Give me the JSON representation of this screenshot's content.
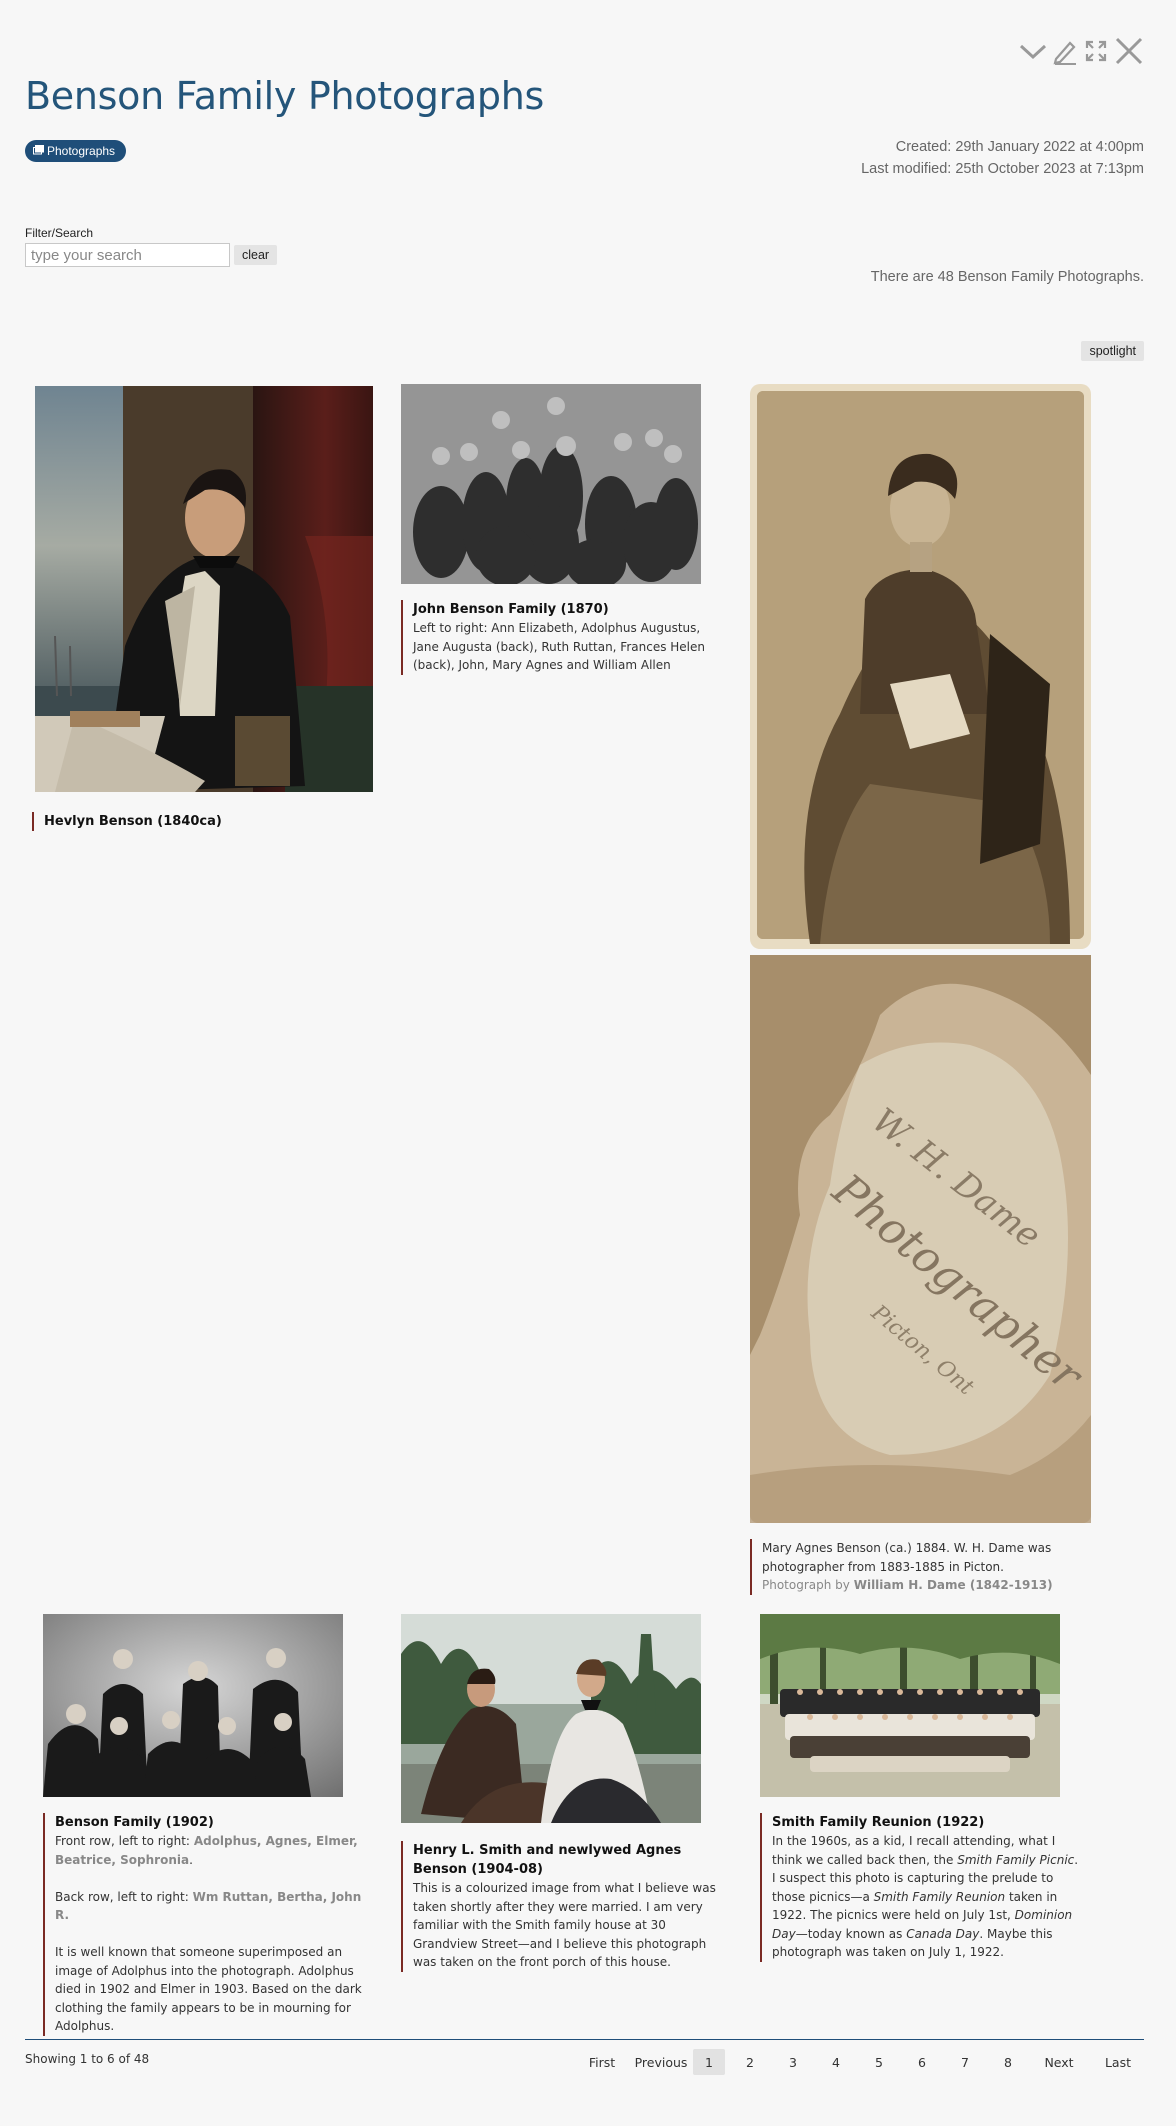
{
  "window_controls": {
    "collapse": "chevron-down-icon",
    "edit": "pencil-icon",
    "expand": "expand-icon",
    "close": "close-icon"
  },
  "title": "Benson Family Photographs",
  "tag": {
    "icon": "photos-icon",
    "label": "Photographs"
  },
  "meta": {
    "created": "Created: 29th January 2022 at 4:00pm",
    "modified": "Last modified: 25th October 2023 at 7:13pm"
  },
  "filter": {
    "label": "Filter/Search",
    "placeholder": "type your search",
    "clear": "clear"
  },
  "count_text": "There are 48 Benson Family Photographs.",
  "spotlight": "spotlight",
  "items": [
    {
      "title": "Hevlyn Benson (1840ca)"
    },
    {
      "title": "John Benson Family (1870)",
      "desc": "Left to right: Ann Elizabeth, Adolphus Augustus, Jane Augusta (back), Ruth Ruttan, Frances Helen (back), John, Mary Agnes and William Allen"
    },
    {
      "desc": "Mary Agnes Benson (ca.) 1884. W. H. Dame was photo­grapher from 1883-1885 in Picton.",
      "credit_prefix": "Photograph by",
      "credit_name": "William H. Dame (1842-1913)",
      "back_text_1": "W. H. Dame",
      "back_text_2": "Photographer",
      "back_text_3": "Picton, Ont"
    },
    {
      "title": "Benson Family (1902)",
      "front_prefix": "Front row, left to right:",
      "front_names": "Adolphus, Agnes, Elmer, Beatrice, Sophronia",
      "back_prefix": "Back row, left to right:",
      "back_names": "Wm Ruttan, Bertha, John R.",
      "note": "It is well known that someone superimposed an image of Adolphus into the photograph. Adolphus died in 1902 and Elmer in 1903. Based on the dark clothing the family appears to be in mourning for Adolphus."
    },
    {
      "title": "Henry L. Smith and newlywed Agnes Benson (1904-08)",
      "desc": "This is a colourized image from what I believe was taken shortly after they were married. I am very famil­iar with the Smith family house at 30 Grandview Street—and I believe this photograph was taken on the front porch of this house."
    },
    {
      "title": "Smith Family Reunion (1922)",
      "p1": "In the 1960s, as a kid, I recall attending, what I think we called back then, the",
      "em1": "Smith Family Picnic",
      "p2": ". I suspect this photo is capturing the prelude to those picnics—a",
      "em2": "Smith Family Reunion",
      "p3": "taken in 1922. The picnics were held on July 1st,",
      "em3": "Dominion Day",
      "p4": "—today known as",
      "em4": "Canada Day",
      "p5": ". Maybe this photograph was taken on July 1, 1922."
    }
  ],
  "pagination": {
    "showing": "Showing 1 to 6 of 48",
    "first": "First",
    "previous": "Previous",
    "pages": [
      "1",
      "2",
      "3",
      "4",
      "5",
      "6",
      "7",
      "8"
    ],
    "next": "Next",
    "last": "Last",
    "current": "1"
  }
}
